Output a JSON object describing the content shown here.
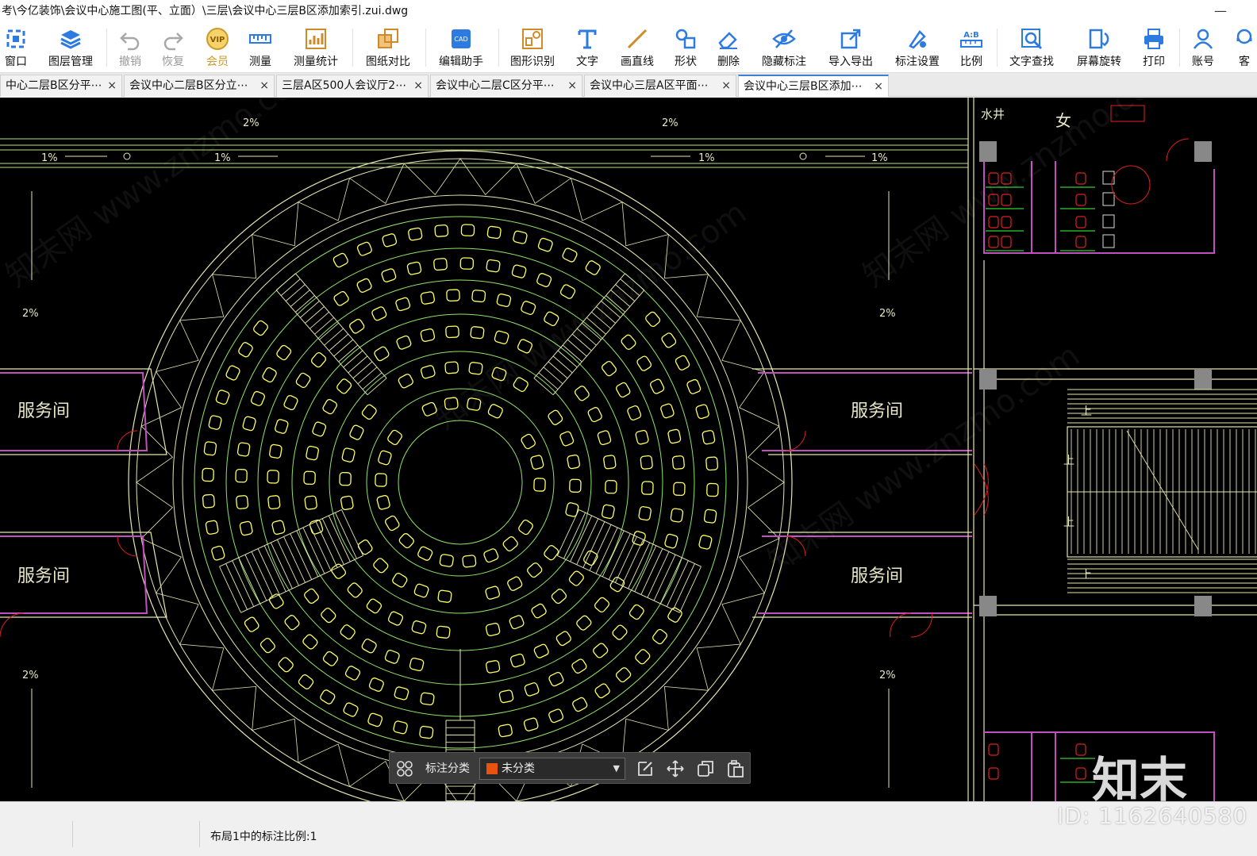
{
  "window": {
    "title": "考\\今亿装饰\\会议中心施工图(平、立面）\\三层\\会议中心三层B区添加索引.zui.dwg",
    "minimize_glyph": "—"
  },
  "toolbar": {
    "items": [
      {
        "label": "窗口",
        "icon": "window-icon"
      },
      {
        "label": "图层管理",
        "icon": "layers-icon"
      },
      {
        "label": "撤销",
        "icon": "undo-icon"
      },
      {
        "label": "恢复",
        "icon": "redo-icon"
      },
      {
        "label": "会员",
        "icon": "vip-icon"
      },
      {
        "label": "测量",
        "icon": "measure-icon"
      },
      {
        "label": "测量统计",
        "icon": "measure-stats-icon"
      },
      {
        "label": "图纸对比",
        "icon": "compare-icon"
      },
      {
        "label": "编辑助手",
        "icon": "cad-edit-icon"
      },
      {
        "label": "图形识别",
        "icon": "shape-recognize-icon"
      },
      {
        "label": "文字",
        "icon": "text-icon"
      },
      {
        "label": "画直线",
        "icon": "line-icon"
      },
      {
        "label": "形状",
        "icon": "shapes-icon"
      },
      {
        "label": "删除",
        "icon": "eraser-icon"
      },
      {
        "label": "隐藏标注",
        "icon": "hide-icon"
      },
      {
        "label": "导入导出",
        "icon": "import-export-icon"
      },
      {
        "label": "标注设置",
        "icon": "annotation-settings-icon"
      },
      {
        "label": "比例",
        "icon": "scale-icon"
      },
      {
        "label": "文字查找",
        "icon": "text-search-icon"
      },
      {
        "label": "屏幕旋转",
        "icon": "rotate-screen-icon"
      },
      {
        "label": "打印",
        "icon": "print-icon"
      },
      {
        "label": "账号",
        "icon": "account-icon"
      },
      {
        "label": "客",
        "icon": "service-icon"
      }
    ]
  },
  "tabs": [
    {
      "label": "中心二层B区分平⋯",
      "close": "×"
    },
    {
      "label": "会议中心二层B区分立⋯",
      "close": "×"
    },
    {
      "label": "三层A区500人会议厅2⋯",
      "close": "×"
    },
    {
      "label": "会议中心二层C区分平⋯",
      "close": "×"
    },
    {
      "label": "会议中心三层A区平面⋯",
      "close": "×"
    },
    {
      "label": "会议中心三层B区添加⋯",
      "close": "×"
    }
  ],
  "drawing": {
    "slope_labels": {
      "top_left": "2%",
      "top_right": "2%",
      "left_1": "1%",
      "left_2": "1%",
      "right_1": "1%",
      "right_2": "1%",
      "mid_left": "2%",
      "mid_right": "2%",
      "low_left": "2%",
      "low_right": "2%"
    },
    "rooms": {
      "service_ul": "服务间",
      "service_ur": "服务间",
      "service_ll": "服务间",
      "service_lr": "服务间"
    },
    "restroom_label": "女",
    "shaft_label": "水井",
    "stair_up": [
      "上",
      "上",
      "上",
      "上"
    ],
    "colors": {
      "background": "#000000",
      "wall": "#e6e6b0",
      "seat": "#ffff66",
      "ring": "#8fe36a",
      "partition": "#c050c0",
      "toilet_red": "#e02020",
      "toilet_green": "#30d030"
    }
  },
  "annotation_bar": {
    "label": "标注分类",
    "selected": "未分类",
    "swatch_color": "#e8540f",
    "tools": [
      "edit-icon",
      "move-icon",
      "copy-icon",
      "paste-icon"
    ]
  },
  "status": {
    "scale_text": "布局1中的标注比例:1"
  },
  "watermark": {
    "logo": "知末",
    "id": "ID: 1162640580"
  }
}
